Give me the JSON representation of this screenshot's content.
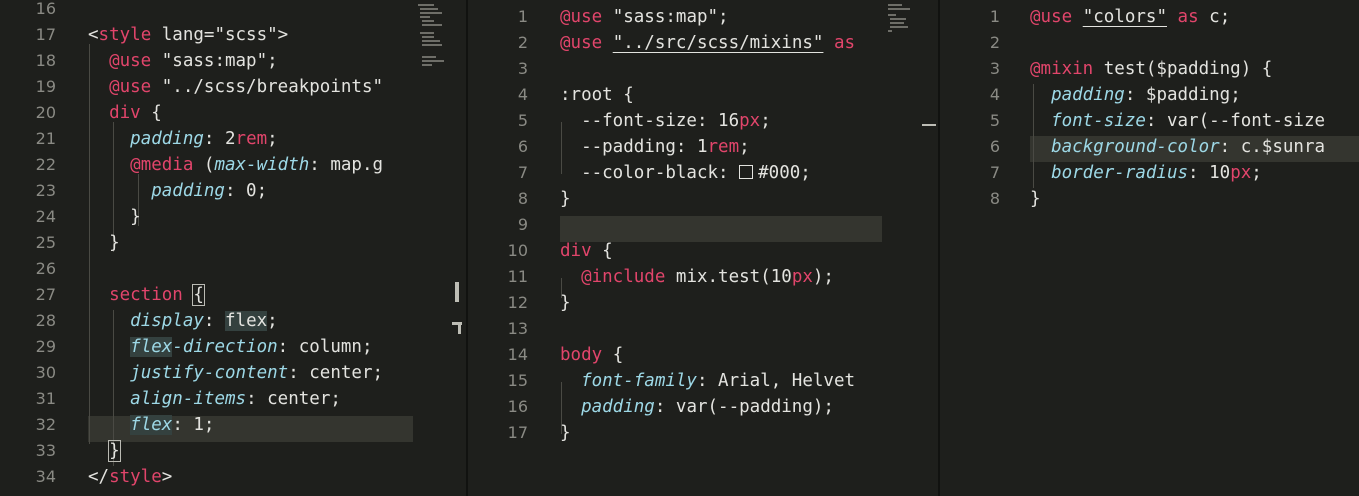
{
  "panes": [
    {
      "name": "pane-left",
      "lines": [
        {
          "n": "16",
          "tokens": []
        },
        {
          "n": "17",
          "tokens": [
            [
              "<",
              "p"
            ],
            [
              "style",
              "kw"
            ],
            [
              " lang=\"scss\">",
              "p"
            ]
          ]
        },
        {
          "n": "18",
          "tokens": [
            [
              "  ",
              "p"
            ],
            [
              "@use",
              "kw"
            ],
            [
              " \"sass:map\";",
              "p"
            ]
          ]
        },
        {
          "n": "19",
          "tokens": [
            [
              "  ",
              "p"
            ],
            [
              "@use",
              "kw"
            ],
            [
              " \"../scss/breakpoints\"",
              "p"
            ]
          ]
        },
        {
          "n": "20",
          "tokens": [
            [
              "  ",
              "p"
            ],
            [
              "div",
              "sel"
            ],
            [
              " {",
              "p"
            ]
          ]
        },
        {
          "n": "21",
          "tokens": [
            [
              "    ",
              "p"
            ],
            [
              "padding",
              "prop"
            ],
            [
              ": 2",
              "p"
            ],
            [
              "rem",
              "un"
            ],
            [
              ";",
              "p"
            ]
          ]
        },
        {
          "n": "22",
          "tokens": [
            [
              "    ",
              "p"
            ],
            [
              "@media",
              "kw"
            ],
            [
              " (",
              "p"
            ],
            [
              "max-width",
              "prop"
            ],
            [
              ": map.g",
              "p"
            ]
          ]
        },
        {
          "n": "23",
          "tokens": [
            [
              "      ",
              "p"
            ],
            [
              "padding",
              "prop"
            ],
            [
              ": 0;",
              "p"
            ]
          ]
        },
        {
          "n": "24",
          "tokens": [
            [
              "    }",
              "p"
            ]
          ]
        },
        {
          "n": "25",
          "tokens": [
            [
              "  }",
              "p"
            ]
          ]
        },
        {
          "n": "26",
          "tokens": []
        },
        {
          "n": "27",
          "tokens": [
            [
              "  ",
              "p"
            ],
            [
              "section",
              "sel"
            ],
            [
              " ",
              "p"
            ],
            [
              "{",
              "box"
            ]
          ]
        },
        {
          "n": "28",
          "tokens": [
            [
              "    ",
              "p"
            ],
            [
              "display",
              "prop"
            ],
            [
              ": ",
              "p"
            ],
            [
              "flex",
              "bgflex"
            ],
            [
              ";",
              "p"
            ]
          ]
        },
        {
          "n": "29",
          "tokens": [
            [
              "    ",
              "p"
            ],
            [
              "flex",
              "prop-bg"
            ],
            [
              "-direction",
              "prop"
            ],
            [
              ": column;",
              "p"
            ]
          ]
        },
        {
          "n": "30",
          "tokens": [
            [
              "    ",
              "p"
            ],
            [
              "justify-content",
              "prop"
            ],
            [
              ": center;",
              "p"
            ]
          ]
        },
        {
          "n": "31",
          "tokens": [
            [
              "    ",
              "p"
            ],
            [
              "align-items",
              "prop"
            ],
            [
              ": center;",
              "p"
            ]
          ]
        },
        {
          "n": "32",
          "tokens": [
            [
              "    ",
              "p"
            ],
            [
              "flex",
              "prop-bg"
            ],
            [
              ": 1;",
              "p"
            ]
          ]
        },
        {
          "n": "33",
          "tokens": [
            [
              "  ",
              "p"
            ],
            [
              "}",
              "box"
            ]
          ]
        },
        {
          "n": "34",
          "tokens": [
            [
              "</",
              "p"
            ],
            [
              "style",
              "kw"
            ],
            [
              ">",
              "p"
            ]
          ]
        }
      ]
    },
    {
      "name": "pane-middle",
      "lines": [
        {
          "n": "1",
          "tokens": [
            [
              "@use",
              "kw"
            ],
            [
              " \"sass:map\";",
              "p"
            ]
          ]
        },
        {
          "n": "2",
          "tokens": [
            [
              "@use",
              "kw"
            ],
            [
              " ",
              "p"
            ],
            [
              "\"../src/scss/mixins\"",
              "ul"
            ],
            [
              " as",
              "kw"
            ]
          ]
        },
        {
          "n": "3",
          "tokens": []
        },
        {
          "n": "4",
          "tokens": [
            [
              ":root {",
              "p"
            ]
          ]
        },
        {
          "n": "5",
          "tokens": [
            [
              "  --font-size: 16",
              "p"
            ],
            [
              "px",
              "un"
            ],
            [
              ";",
              "p"
            ]
          ]
        },
        {
          "n": "6",
          "tokens": [
            [
              "  --padding: 1",
              "p"
            ],
            [
              "rem",
              "un"
            ],
            [
              ";",
              "p"
            ]
          ]
        },
        {
          "n": "7",
          "tokens": [
            [
              "  --color-black: ",
              "p"
            ],
            [
              "",
              "swatch"
            ],
            [
              "#000;",
              "p"
            ]
          ]
        },
        {
          "n": "8",
          "tokens": [
            [
              "}",
              "p"
            ]
          ]
        },
        {
          "n": "9",
          "tokens": []
        },
        {
          "n": "10",
          "tokens": [
            [
              "div",
              "sel"
            ],
            [
              " {",
              "p"
            ]
          ]
        },
        {
          "n": "11",
          "tokens": [
            [
              "  ",
              "p"
            ],
            [
              "@include",
              "kw"
            ],
            [
              " mix.test(10",
              "p"
            ],
            [
              "px",
              "un"
            ],
            [
              ");",
              "p"
            ]
          ]
        },
        {
          "n": "12",
          "tokens": [
            [
              "}",
              "p"
            ]
          ]
        },
        {
          "n": "13",
          "tokens": []
        },
        {
          "n": "14",
          "tokens": [
            [
              "body",
              "sel"
            ],
            [
              " {",
              "p"
            ]
          ]
        },
        {
          "n": "15",
          "tokens": [
            [
              "  ",
              "p"
            ],
            [
              "font-family",
              "prop"
            ],
            [
              ": Arial, Helvet",
              "p"
            ]
          ]
        },
        {
          "n": "16",
          "tokens": [
            [
              "  ",
              "p"
            ],
            [
              "padding",
              "prop"
            ],
            [
              ": var(--padding);",
              "p"
            ]
          ]
        },
        {
          "n": "17",
          "tokens": [
            [
              "}",
              "p"
            ]
          ]
        }
      ]
    },
    {
      "name": "pane-right",
      "lines": [
        {
          "n": "1",
          "tokens": [
            [
              "@use",
              "kw"
            ],
            [
              " ",
              "p"
            ],
            [
              "\"colors\"",
              "ul"
            ],
            [
              " ",
              "p"
            ],
            [
              "as",
              "kw"
            ],
            [
              " c;",
              "p"
            ]
          ]
        },
        {
          "n": "2",
          "tokens": []
        },
        {
          "n": "3",
          "tokens": [
            [
              "@mixin",
              "kw"
            ],
            [
              " test($padding) {",
              "p"
            ]
          ]
        },
        {
          "n": "4",
          "tokens": [
            [
              "  ",
              "p"
            ],
            [
              "padding",
              "prop"
            ],
            [
              ": $padding;",
              "p"
            ]
          ]
        },
        {
          "n": "5",
          "tokens": [
            [
              "  ",
              "p"
            ],
            [
              "font-size",
              "prop"
            ],
            [
              ": var(--font-size",
              "p"
            ]
          ]
        },
        {
          "n": "6",
          "tokens": [
            [
              "  ",
              "p"
            ],
            [
              "background-color",
              "prop"
            ],
            [
              ": c.$sunra",
              "p"
            ]
          ]
        },
        {
          "n": "7",
          "tokens": [
            [
              "  ",
              "p"
            ],
            [
              "border-radius",
              "prop"
            ],
            [
              ": 10",
              "p"
            ],
            [
              "px",
              "un"
            ],
            [
              ";",
              "p"
            ]
          ]
        },
        {
          "n": "8",
          "tokens": [
            [
              "}",
              "p"
            ]
          ]
        }
      ]
    }
  ]
}
